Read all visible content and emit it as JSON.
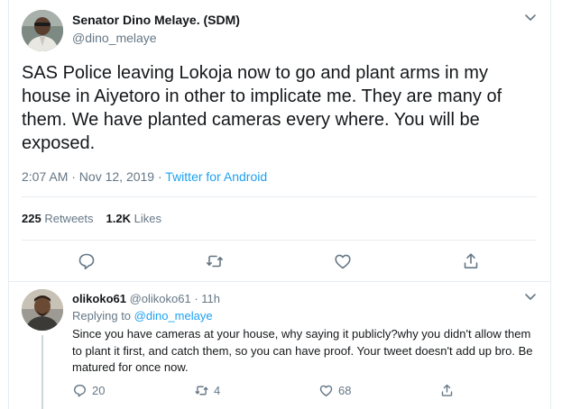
{
  "tweet": {
    "author_name": "Senator Dino Melaye. (SDM)",
    "author_handle": "@dino_melaye",
    "text": "SAS Police leaving Lokoja now to go and plant arms in my house in Aiyetoro in other to implicate me. They are many of them. We have planted cameras every where. You will be exposed.",
    "timestamp": "2:07 AM · Nov 12, 2019",
    "meta_separator": "·",
    "source": "Twitter for Android",
    "retweets_count": "225",
    "retweets_label": "Retweets",
    "likes_count": "1.2K",
    "likes_label": "Likes"
  },
  "reply": {
    "author_name": "olikoko61",
    "author_handle": "@olikoko61",
    "time": "· 11h",
    "replying_prefix": "Replying to",
    "replying_to": "@dino_melaye",
    "text": "Since you have cameras at your house, why saying it publicly?why you didn't allow them to plant it first, and catch them, so you can have proof. Your tweet doesn't add up bro. Be matured for once now.",
    "replies": "20",
    "retweets": "4",
    "likes": "68"
  },
  "icons": {
    "main_actions": [
      "reply-icon",
      "retweet-icon",
      "like-icon",
      "share-icon"
    ],
    "menu": "chevron-down-icon",
    "accent": "#1da1f2",
    "muted": "#657786"
  }
}
